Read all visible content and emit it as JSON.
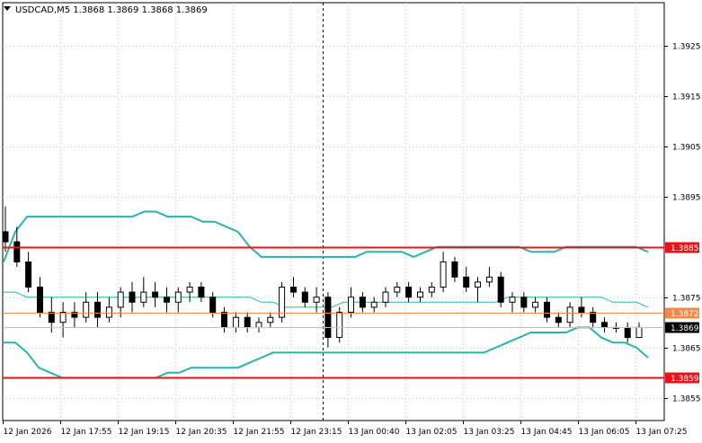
{
  "header": {
    "symbol_line": "USDCAD,M5  1.3868 1.3869 1.3868 1.3869"
  },
  "chart_data": {
    "type": "candlestick",
    "symbol": "USDCAD",
    "timeframe": "M5",
    "ohlc_header": {
      "open": "1.3868",
      "high": "1.3869",
      "low": "1.3868",
      "close": "1.3869"
    },
    "ylim": [
      1.38505,
      1.39335
    ],
    "y_ticks": [
      "1.3925",
      "1.3915",
      "1.3905",
      "1.3895",
      "1.3875",
      "1.3865",
      "1.3855"
    ],
    "x_ticks": [
      "12 Jan 2026",
      "12 Jan 17:55",
      "12 Jan 19:15",
      "12 Jan 20:35",
      "12 Jan 21:55",
      "12 Jan 23:15",
      "13 Jan 00:40",
      "13 Jan 02:05",
      "13 Jan 03:25",
      "13 Jan 04:45",
      "13 Jan 06:05",
      "13 Jan 07:25"
    ],
    "grid": true,
    "horizontal_levels": [
      {
        "label": "1.3885",
        "value": 1.3885,
        "color": "#e8141a"
      },
      {
        "label": "1.3872",
        "value": 1.3872,
        "color": "#f08a48"
      },
      {
        "label": "1.3869",
        "value": 1.3869,
        "color": "#000000"
      },
      {
        "label": "1.3859",
        "value": 1.3859,
        "color": "#e8141a"
      }
    ],
    "bollinger_color": "#26b5ad",
    "bollinger_upper": [
      1.3882,
      1.3888,
      1.3891,
      1.3891,
      1.3891,
      1.3891,
      1.3891,
      1.3891,
      1.3891,
      1.3891,
      1.3891,
      1.3891,
      1.3892,
      1.3892,
      1.3891,
      1.3891,
      1.3891,
      1.389,
      1.389,
      1.3889,
      1.3888,
      1.3885,
      1.3883,
      1.3883,
      1.3883,
      1.3883,
      1.3883,
      1.3883,
      1.3883,
      1.3883,
      1.3883,
      1.3884,
      1.3884,
      1.3884,
      1.3884,
      1.3883,
      1.3884,
      1.3885,
      1.3885,
      1.3885,
      1.3885,
      1.3885,
      1.3885,
      1.3885,
      1.3885,
      1.3884,
      1.3884,
      1.3884,
      1.3885,
      1.3885,
      1.3885,
      1.3885,
      1.3885,
      1.3885,
      1.3885,
      1.3884
    ],
    "bollinger_middle": [
      1.3876,
      1.3876,
      1.3875,
      1.3875,
      1.3875,
      1.3875,
      1.3875,
      1.3875,
      1.3875,
      1.3875,
      1.3875,
      1.3875,
      1.3875,
      1.3875,
      1.3875,
      1.3875,
      1.3875,
      1.3875,
      1.3875,
      1.3875,
      1.3875,
      1.3875,
      1.3874,
      1.3874,
      1.3873,
      1.3873,
      1.3873,
      1.3873,
      1.3873,
      1.3874,
      1.3874,
      1.3874,
      1.3874,
      1.3874,
      1.3874,
      1.3874,
      1.3874,
      1.3874,
      1.3874,
      1.3874,
      1.3874,
      1.3874,
      1.3874,
      1.3875,
      1.3875,
      1.3875,
      1.3875,
      1.3875,
      1.3875,
      1.3875,
      1.3875,
      1.3875,
      1.3874,
      1.3874,
      1.3874,
      1.3873
    ],
    "bollinger_lower": [
      1.3866,
      1.3866,
      1.3864,
      1.3861,
      1.386,
      1.3859,
      1.3859,
      1.3859,
      1.3859,
      1.3859,
      1.3859,
      1.3859,
      1.3859,
      1.3859,
      1.386,
      1.386,
      1.3861,
      1.3861,
      1.3861,
      1.3861,
      1.3861,
      1.3862,
      1.3863,
      1.3864,
      1.3864,
      1.3864,
      1.3864,
      1.3864,
      1.3864,
      1.3864,
      1.3864,
      1.3864,
      1.3864,
      1.3864,
      1.3864,
      1.3864,
      1.3864,
      1.3864,
      1.3864,
      1.3864,
      1.3864,
      1.3864,
      1.3865,
      1.3866,
      1.3867,
      1.3868,
      1.3868,
      1.3868,
      1.3868,
      1.3869,
      1.3869,
      1.3867,
      1.3866,
      1.3866,
      1.3865,
      1.3863
    ],
    "candles": [
      [
        1.3888,
        1.3893,
        1.3884,
        1.3886
      ],
      [
        1.3886,
        1.3889,
        1.3881,
        1.3882
      ],
      [
        1.3882,
        1.3884,
        1.3876,
        1.3877
      ],
      [
        1.3877,
        1.3879,
        1.3871,
        1.3872
      ],
      [
        1.3872,
        1.3875,
        1.3868,
        1.387
      ],
      [
        1.387,
        1.3874,
        1.3867,
        1.3872
      ],
      [
        1.3872,
        1.3874,
        1.3869,
        1.3871
      ],
      [
        1.3871,
        1.3876,
        1.387,
        1.3874
      ],
      [
        1.3874,
        1.3876,
        1.3869,
        1.3871
      ],
      [
        1.3871,
        1.3875,
        1.387,
        1.3873
      ],
      [
        1.3873,
        1.3877,
        1.3871,
        1.3876
      ],
      [
        1.3876,
        1.3878,
        1.3872,
        1.3874
      ],
      [
        1.3874,
        1.3879,
        1.3873,
        1.3876
      ],
      [
        1.3876,
        1.3878,
        1.3873,
        1.3875
      ],
      [
        1.3875,
        1.3877,
        1.3872,
        1.3874
      ],
      [
        1.3874,
        1.3877,
        1.3872,
        1.3876
      ],
      [
        1.3876,
        1.3878,
        1.3874,
        1.3877
      ],
      [
        1.3877,
        1.3878,
        1.3874,
        1.3875
      ],
      [
        1.3875,
        1.3876,
        1.3871,
        1.3872
      ],
      [
        1.3872,
        1.3873,
        1.3868,
        1.3869
      ],
      [
        1.3869,
        1.3872,
        1.3868,
        1.3871
      ],
      [
        1.3871,
        1.3872,
        1.3868,
        1.3869
      ],
      [
        1.3869,
        1.3871,
        1.3868,
        1.387
      ],
      [
        1.387,
        1.3872,
        1.3869,
        1.3871
      ],
      [
        1.3871,
        1.3878,
        1.387,
        1.3877
      ],
      [
        1.3877,
        1.3879,
        1.3875,
        1.3876
      ],
      [
        1.3876,
        1.3877,
        1.3873,
        1.3874
      ],
      [
        1.3874,
        1.3877,
        1.3872,
        1.3875
      ],
      [
        1.3875,
        1.3876,
        1.3865,
        1.3867
      ],
      [
        1.3867,
        1.3873,
        1.3866,
        1.3872
      ],
      [
        1.3872,
        1.3877,
        1.3871,
        1.3875
      ],
      [
        1.3875,
        1.3876,
        1.3872,
        1.3873
      ],
      [
        1.3873,
        1.3875,
        1.3872,
        1.3874
      ],
      [
        1.3874,
        1.3877,
        1.3873,
        1.3876
      ],
      [
        1.3876,
        1.3878,
        1.3875,
        1.3877
      ],
      [
        1.3877,
        1.3878,
        1.3874,
        1.3875
      ],
      [
        1.3875,
        1.3877,
        1.3874,
        1.3876
      ],
      [
        1.3876,
        1.3878,
        1.3875,
        1.3877
      ],
      [
        1.3877,
        1.3884,
        1.3876,
        1.3882
      ],
      [
        1.3882,
        1.3883,
        1.3878,
        1.3879
      ],
      [
        1.3879,
        1.3881,
        1.3876,
        1.3877
      ],
      [
        1.3877,
        1.3879,
        1.3874,
        1.3878
      ],
      [
        1.3878,
        1.3881,
        1.3877,
        1.3879
      ],
      [
        1.3879,
        1.388,
        1.3873,
        1.3874
      ],
      [
        1.3874,
        1.3876,
        1.3872,
        1.3875
      ],
      [
        1.3875,
        1.3876,
        1.3872,
        1.3873
      ],
      [
        1.3873,
        1.3875,
        1.3872,
        1.3874
      ],
      [
        1.3874,
        1.3875,
        1.387,
        1.3871
      ],
      [
        1.3871,
        1.3872,
        1.3869,
        1.387
      ],
      [
        1.387,
        1.3874,
        1.3869,
        1.3873
      ],
      [
        1.3873,
        1.3875,
        1.3871,
        1.3872
      ],
      [
        1.3872,
        1.3873,
        1.3869,
        1.387
      ],
      [
        1.387,
        1.3871,
        1.3868,
        1.3869
      ],
      [
        1.3869,
        1.387,
        1.3868,
        1.3869
      ],
      [
        1.3869,
        1.387,
        1.3866,
        1.3867
      ],
      [
        1.3867,
        1.387,
        1.3867,
        1.3869
      ]
    ]
  }
}
